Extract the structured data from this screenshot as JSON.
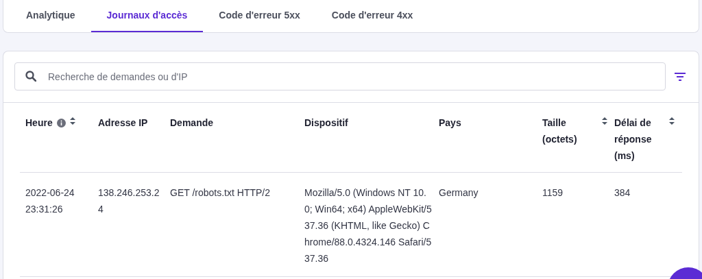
{
  "tabs": [
    {
      "label": "Analytique",
      "selected": false
    },
    {
      "label": "Journaux d'accès",
      "selected": true
    },
    {
      "label": "Code d'erreur 5xx",
      "selected": false
    },
    {
      "label": "Code d'erreur 4xx",
      "selected": false
    }
  ],
  "search": {
    "placeholder": "Recherche de demandes ou d'IP"
  },
  "table": {
    "columns": [
      {
        "label": "Heure",
        "info": true,
        "sortable": true
      },
      {
        "label": "Adresse IP",
        "info": false,
        "sortable": false
      },
      {
        "label": "Demande",
        "info": false,
        "sortable": false
      },
      {
        "label": "Dispositif",
        "info": false,
        "sortable": false
      },
      {
        "label": "Pays",
        "info": false,
        "sortable": false
      },
      {
        "label": "Taille (octets)",
        "info": false,
        "sortable": true
      },
      {
        "label": "Délai de réponse (ms)",
        "info": false,
        "sortable": true
      }
    ],
    "rows": [
      [
        "2022-06-24 23:31:26",
        "138.246.253.24",
        "GET /robots.txt HTTP/2",
        "Mozilla/5.0 (Windows NT 10.0; Win64; x64) AppleWebKit/537.36 (KHTML, like Gecko) Chrome/88.0.4324.146 Safari/537.36",
        "Germany",
        "1159",
        "384"
      ]
    ]
  }
}
